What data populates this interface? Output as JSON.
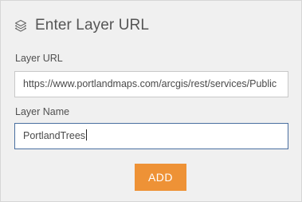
{
  "header": {
    "icon": "layers-icon",
    "title": "Enter Layer URL"
  },
  "layer_url": {
    "label": "Layer URL",
    "value": "https://www.portlandmaps.com/arcgis/rest/services/Public"
  },
  "layer_name": {
    "label": "Layer Name",
    "value": "PortlandTrees"
  },
  "add_button": {
    "label": "ADD",
    "color": "#ee9236"
  }
}
